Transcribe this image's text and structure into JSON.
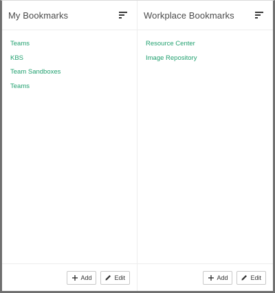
{
  "my_bookmarks": {
    "title": "My Bookmarks",
    "links": [
      "Teams",
      "KBS",
      "Team Sandboxes",
      "Teams"
    ],
    "add_label": "Add",
    "edit_label": "Edit"
  },
  "workplace_bookmarks": {
    "title": "Workplace Bookmarks",
    "links": [
      "Resource Center",
      "Image Repository"
    ],
    "add_label": "Add",
    "edit_label": "Edit"
  },
  "colors": {
    "link": "#21a06f",
    "title": "#4a4a4a",
    "frame": "#6f6f6f"
  },
  "icons": {
    "sort": "sort-icon",
    "add": "plus-icon",
    "edit": "pencil-icon"
  }
}
